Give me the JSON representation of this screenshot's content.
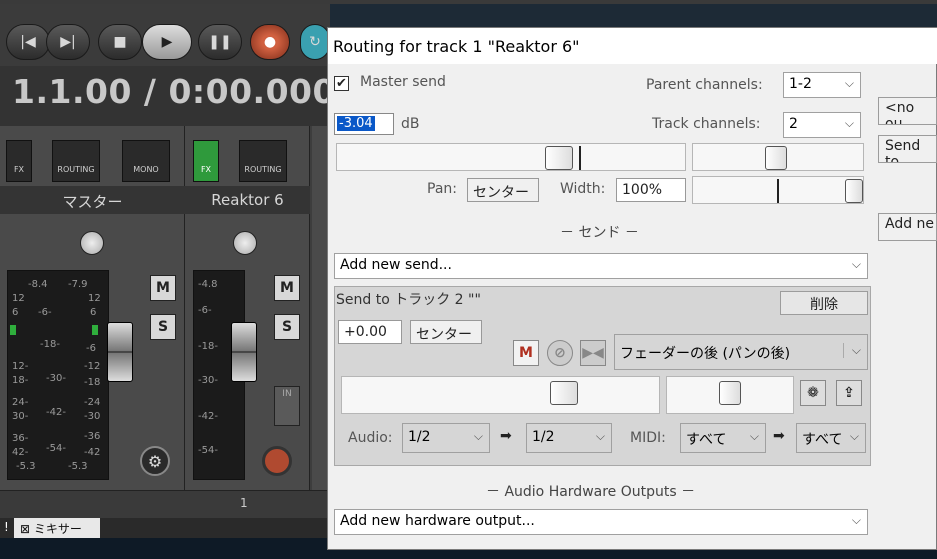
{
  "mixer": {
    "time_display": "1.1.00 / 0:00.000",
    "transport_buttons": [
      "skip-back",
      "skip-forward",
      "stop",
      "play",
      "pause",
      "record"
    ],
    "strips": [
      {
        "name": "マスター",
        "fx": "FX",
        "routing": "ROUTING",
        "mono": "MONO",
        "meter_left": "-8.4",
        "meter_right": "-7.9",
        "meter_bottom_l": "-5.3",
        "meter_bottom_r": "-5.3"
      },
      {
        "name": "Reaktor 6",
        "fx": "FX",
        "routing": "ROUTING",
        "meter_left": "-4.8",
        "track_number": "1"
      }
    ],
    "scale_left": [
      "12",
      "6",
      "-6-",
      "-18-",
      "12-",
      "-30-",
      "18-",
      "24-",
      "-42-",
      "30-",
      "36-",
      "-54-",
      "42-"
    ],
    "scale_right": [
      "12",
      "6",
      "-6",
      "-12",
      "-18",
      "-24",
      "-30",
      "-36",
      "-42"
    ],
    "track2_scale": [
      "-6-",
      "-18-",
      "-30-",
      "-42-",
      "-54-"
    ],
    "m_label": "M",
    "s_label": "S",
    "in_label": "IN",
    "tab_label": "ミキサー",
    "tab_exclaim": "!",
    "tab_close": "⊠"
  },
  "dialog": {
    "title": "Routing for track 1 \"Reaktor 6\"",
    "master_send_label": "Master send",
    "master_send_checked": true,
    "volume_value": "-3.04",
    "volume_unit": "dB",
    "parent_channels_label": "Parent channels:",
    "parent_channels_value": "1-2",
    "track_channels_label": "Track channels:",
    "track_channels_value": "2",
    "pan_label": "Pan:",
    "pan_value": "センター",
    "width_label": "Width:",
    "width_value": "100%",
    "sends_header": "－ センド －",
    "add_new_send": "Add new send...",
    "send": {
      "title": "Send to トラック 2 \"\"",
      "delete_label": "削除",
      "volume": "+0.00",
      "pan": "センター",
      "mute_label": "M",
      "mode_value": "フェーダーの後 (パンの後)",
      "audio_label": "Audio:",
      "audio_src": "1/2",
      "audio_dst": "1/2",
      "midi_label": "MIDI:",
      "midi_src": "すべて",
      "midi_dst": "すべて",
      "arrow": "➡"
    },
    "hw_header": "－ Audio Hardware Outputs －",
    "add_new_hw": "Add new hardware output...",
    "right_no_output": "<no ou",
    "right_send_to": "Send to",
    "right_add_new": "Add ne"
  }
}
